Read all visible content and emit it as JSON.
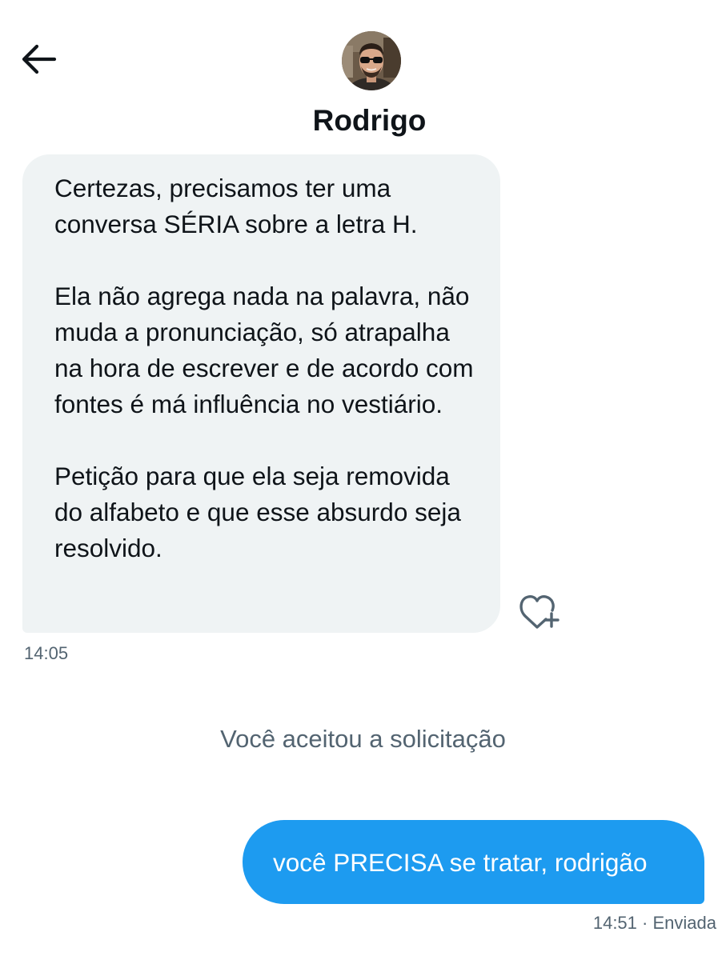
{
  "header": {
    "back_icon": "arrow-left-icon",
    "contact_name": "Rodrigo",
    "avatar_icon": "user-avatar"
  },
  "messages": {
    "incoming": {
      "paragraphs": [
        "Certezas, precisamos ter uma conversa SÉRIA sobre a letra H.",
        "Ela não agrega nada na palavra, não muda a pronunciação, só atrapalha na hora de escrever e de acordo com fontes é má influência no vestiário.",
        "Petição para que ela seja removida do alfabeto e que esse absurdo seja resolvido."
      ],
      "time": "14:05",
      "react_icon": "heart-plus-icon"
    },
    "system_note": "Você aceitou a solicitação",
    "outgoing": {
      "text": "você PRECISA se tratar, rodrigão",
      "time": "14:51",
      "separator": "·",
      "status": "Enviada"
    }
  },
  "colors": {
    "accent": "#1d9bf0",
    "incoming_bubble": "#eff3f4",
    "text_primary": "#0f1419",
    "text_secondary": "#536471"
  }
}
